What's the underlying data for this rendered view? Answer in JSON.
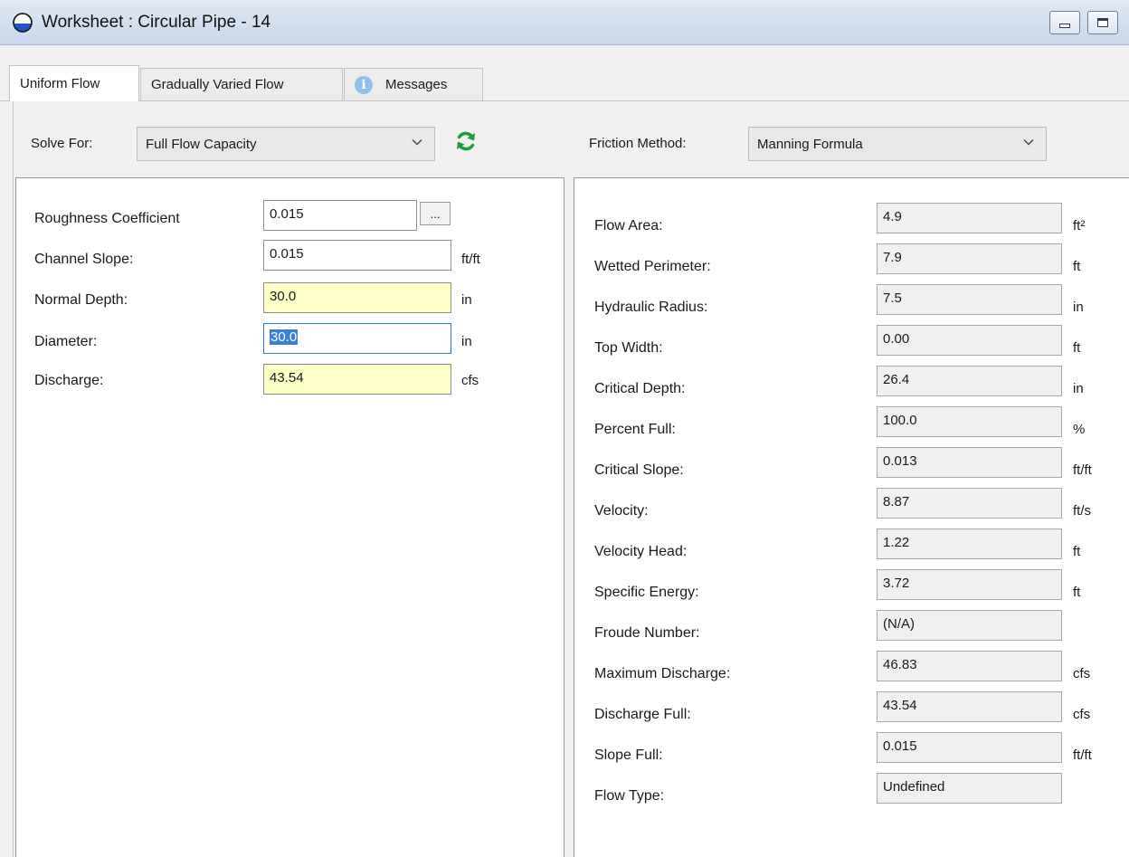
{
  "window": {
    "title": "Worksheet : Circular Pipe - 14"
  },
  "tabs": [
    {
      "label": "Uniform Flow"
    },
    {
      "label": "Gradually Varied Flow"
    },
    {
      "label": "Messages"
    }
  ],
  "toolbar": {
    "solve_for_label": "Solve For:",
    "solve_for_value": "Full Flow Capacity",
    "friction_label": "Friction Method:",
    "friction_value": "Manning Formula"
  },
  "inputs": [
    {
      "label": "Roughness Coefficient",
      "value": "0.015",
      "unit": ""
    },
    {
      "label": "Channel Slope:",
      "value": "0.015",
      "unit": "ft/ft"
    },
    {
      "label": "Normal Depth:",
      "value": "30.0",
      "unit": "in"
    },
    {
      "label": "Diameter:",
      "value": "30.0",
      "unit": "in"
    },
    {
      "label": "Discharge:",
      "value": "43.54",
      "unit": "cfs"
    }
  ],
  "ellipsis_label": "...",
  "results": [
    {
      "label": "Flow Area:",
      "value": "4.9",
      "unit": "ft²"
    },
    {
      "label": "Wetted Perimeter:",
      "value": "7.9",
      "unit": "ft"
    },
    {
      "label": "Hydraulic Radius:",
      "value": "7.5",
      "unit": "in"
    },
    {
      "label": "Top Width:",
      "value": "0.00",
      "unit": "ft"
    },
    {
      "label": "Critical Depth:",
      "value": "26.4",
      "unit": "in"
    },
    {
      "label": "Percent Full:",
      "value": "100.0",
      "unit": "%"
    },
    {
      "label": "Critical Slope:",
      "value": "0.013",
      "unit": "ft/ft"
    },
    {
      "label": "Velocity:",
      "value": "8.87",
      "unit": "ft/s"
    },
    {
      "label": "Velocity Head:",
      "value": "1.22",
      "unit": "ft"
    },
    {
      "label": "Specific Energy:",
      "value": "3.72",
      "unit": "ft"
    },
    {
      "label": "Froude Number:",
      "value": "(N/A)",
      "unit": ""
    },
    {
      "label": "Maximum Discharge:",
      "value": "46.83",
      "unit": "cfs"
    },
    {
      "label": "Discharge Full:",
      "value": "43.54",
      "unit": "cfs"
    },
    {
      "label": "Slope Full:",
      "value": "0.015",
      "unit": "ft/ft"
    },
    {
      "label": "Flow Type:",
      "value": "Undefined",
      "unit": ""
    }
  ],
  "colors": {
    "calculated_field": "#ffffc8",
    "selection": "#3a80d4",
    "refresh_icon": "#1e9b3a"
  }
}
